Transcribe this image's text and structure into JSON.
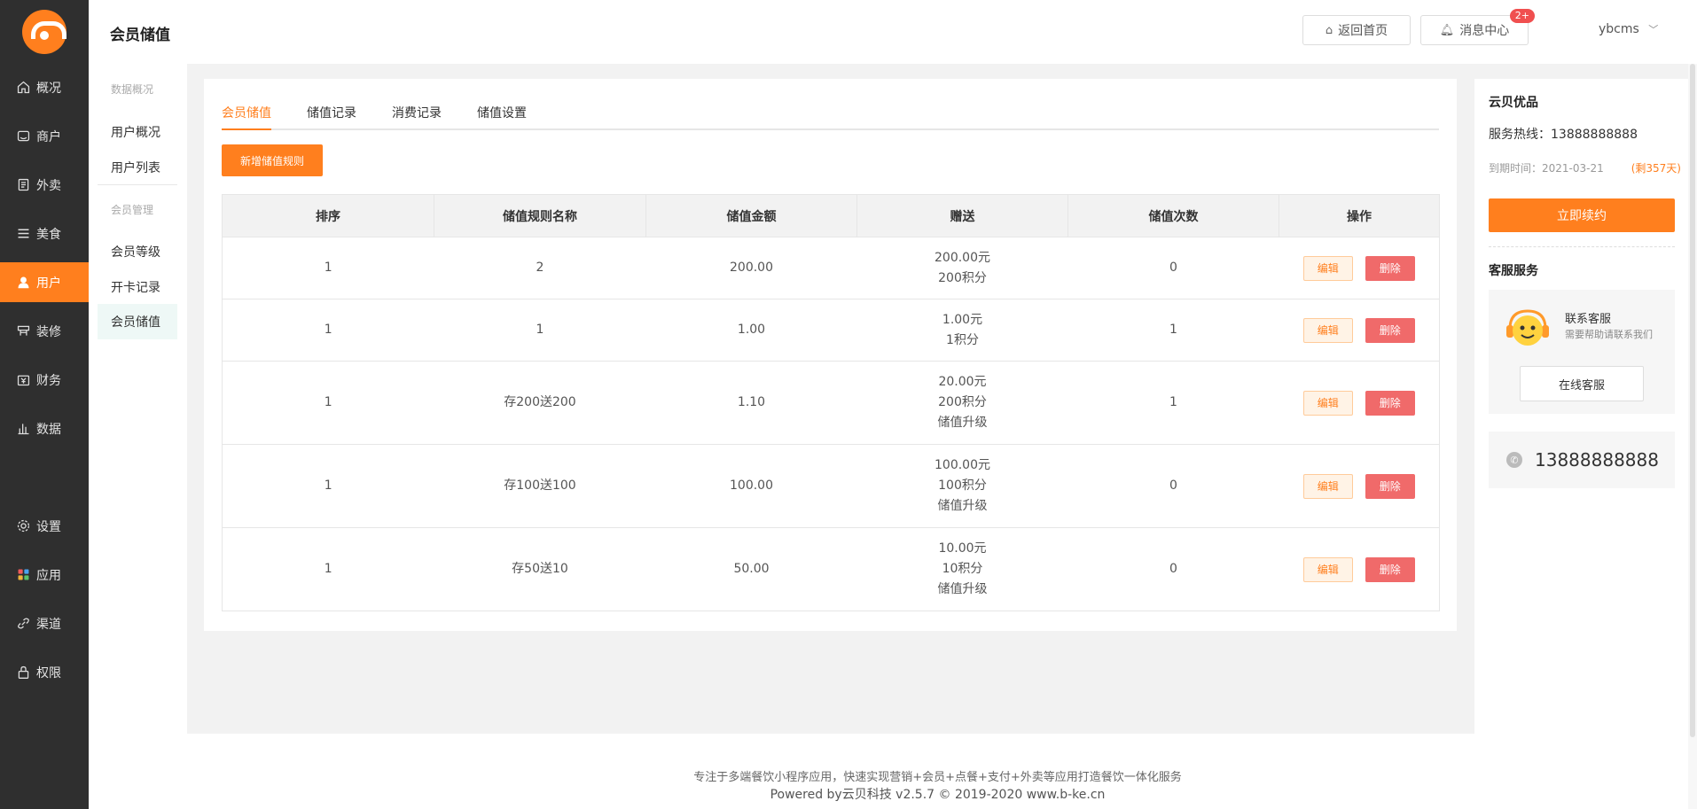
{
  "nav": {
    "items": [
      {
        "label": "概况",
        "icon": "home-icon"
      },
      {
        "label": "商户",
        "icon": "store-icon"
      },
      {
        "label": "外卖",
        "icon": "document-icon"
      },
      {
        "label": "美食",
        "icon": "menu-icon"
      },
      {
        "label": "用户",
        "icon": "user-icon"
      },
      {
        "label": "装修",
        "icon": "decorate-icon"
      },
      {
        "label": "财务",
        "icon": "finance-icon"
      },
      {
        "label": "数据",
        "icon": "bar-chart-icon"
      },
      {
        "label": "设置",
        "icon": "gear-icon"
      },
      {
        "label": "应用",
        "icon": "apps-icon"
      },
      {
        "label": "渠道",
        "icon": "link-icon"
      },
      {
        "label": "权限",
        "icon": "lock-icon"
      }
    ],
    "active": "用户"
  },
  "submenu": {
    "group1_title": "数据概况",
    "item_overview": "用户概况",
    "item_list": "用户列表",
    "group2_title": "会员管理",
    "item_level": "会员等级",
    "item_card": "开卡记录",
    "item_stored": "会员储值"
  },
  "header": {
    "title": "会员储值",
    "home_btn": "返回首页",
    "msg_btn": "消息中心",
    "msg_badge": "2+",
    "user": "ybcms"
  },
  "tabs": [
    "会员储值",
    "储值记录",
    "消费记录",
    "储值设置"
  ],
  "add_button": "新增储值规则",
  "table": {
    "headers": [
      "排序",
      "储值规则名称",
      "储值金额",
      "赠送",
      "储值次数",
      "操作"
    ],
    "edit_label": "编辑",
    "delete_label": "删除",
    "rows": [
      {
        "sort": "1",
        "name": "2",
        "amount": "200.00",
        "gift": [
          "200.00元",
          "200积分"
        ],
        "count": "0"
      },
      {
        "sort": "1",
        "name": "1",
        "amount": "1.00",
        "gift": [
          "1.00元",
          "1积分"
        ],
        "count": "1"
      },
      {
        "sort": "1",
        "name": "存200送200",
        "amount": "1.10",
        "gift": [
          "20.00元",
          "200积分",
          "储值升级"
        ],
        "count": "1"
      },
      {
        "sort": "1",
        "name": "存100送100",
        "amount": "100.00",
        "gift": [
          "100.00元",
          "100积分",
          "储值升级"
        ],
        "count": "0"
      },
      {
        "sort": "1",
        "name": "存50送10",
        "amount": "50.00",
        "gift": [
          "10.00元",
          "10积分",
          "储值升级"
        ],
        "count": "0"
      }
    ]
  },
  "right_panel": {
    "brand": "云贝优品",
    "hotline": "服务热线：13888888888",
    "expire": "到期时间：2021-03-21",
    "remaining": "(剩357天)",
    "renew_button": "立即续约",
    "service_title": "客服服务",
    "cs_title": "联系客服",
    "cs_sub": "需要帮助请联系我们",
    "online_button": "在线客服",
    "phone": "13888888888"
  },
  "footer": {
    "line1": "专注于多端餐饮小程序应用，快速实现营销+会员+点餐+支付+外卖等应用打造餐饮一体化服务",
    "line2": "Powered by云贝科技 v2.5.7 © 2019-2020 www.b-ke.cn"
  },
  "colors": {
    "accent": "#ff7f1e",
    "sidebar": "#2f2f2f",
    "danger": "#f06a6a"
  }
}
